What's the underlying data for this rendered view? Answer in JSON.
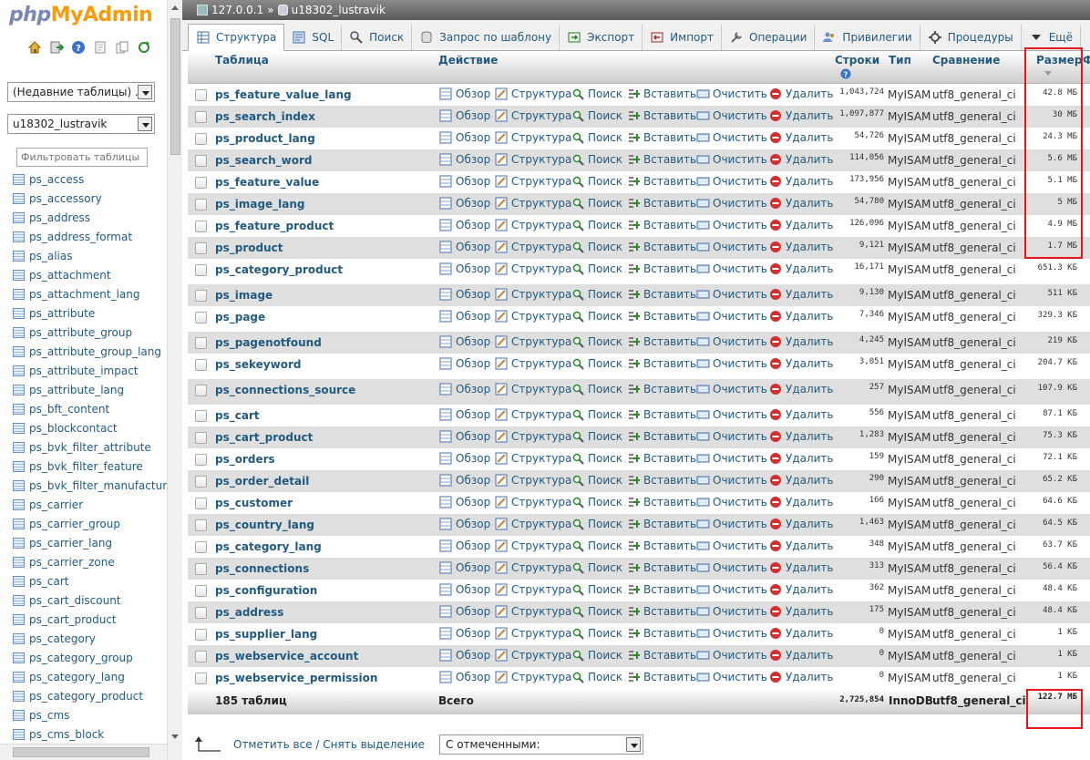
{
  "app": {
    "logo_php": "php",
    "logo_my": "My",
    "logo_admin": "Admin"
  },
  "left": {
    "recent_select": "(Недавние таблицы) ...",
    "db_select": "u18302_lustravik",
    "filter_placeholder": "Фильтровать таблицы по",
    "tables": [
      "ps_access",
      "ps_accessory",
      "ps_address",
      "ps_address_format",
      "ps_alias",
      "ps_attachment",
      "ps_attachment_lang",
      "ps_attribute",
      "ps_attribute_group",
      "ps_attribute_group_lang",
      "ps_attribute_impact",
      "ps_attribute_lang",
      "ps_bft_content",
      "ps_blockcontact",
      "ps_bvk_filter_attribute",
      "ps_bvk_filter_feature",
      "ps_bvk_filter_manufacturer",
      "ps_carrier",
      "ps_carrier_group",
      "ps_carrier_lang",
      "ps_carrier_zone",
      "ps_cart",
      "ps_cart_discount",
      "ps_cart_product",
      "ps_category",
      "ps_category_group",
      "ps_category_lang",
      "ps_category_product",
      "ps_cms",
      "ps_cms_block"
    ]
  },
  "breadcrumb": {
    "server": "127.0.0.1",
    "sep": "»",
    "database": "u18302_lustravik"
  },
  "tabs": [
    {
      "label": "Структура",
      "active": true
    },
    {
      "label": "SQL"
    },
    {
      "label": "Поиск"
    },
    {
      "label": "Запрос по шаблону"
    },
    {
      "label": "Экспорт"
    },
    {
      "label": "Импорт"
    },
    {
      "label": "Операции"
    },
    {
      "label": "Привилегии"
    },
    {
      "label": "Процедуры"
    },
    {
      "label": "Ещё"
    }
  ],
  "columns": {
    "table": "Таблица",
    "action": "Действие",
    "rows": "Строки",
    "type": "Тип",
    "collation": "Сравнение",
    "size": "Размер",
    "overhead_cut": "Ф"
  },
  "actions": {
    "browse": "Обзор",
    "structure": "Структура",
    "search": "Поиск",
    "insert": "Вставить",
    "empty": "Очистить",
    "drop": "Удалить"
  },
  "rows": [
    {
      "name": "ps_feature_value_lang",
      "rows": "1,043,724",
      "engine": "MyISAM",
      "collation": "utf8_general_ci",
      "size": "42.8 МБ"
    },
    {
      "name": "ps_search_index",
      "rows": "1,097,877",
      "engine": "MyISAM",
      "collation": "utf8_general_ci",
      "size": "30 МБ"
    },
    {
      "name": "ps_product_lang",
      "rows": "54,726",
      "engine": "MyISAM",
      "collation": "utf8_general_ci",
      "size": "24.3 МБ"
    },
    {
      "name": "ps_search_word",
      "rows": "114,056",
      "engine": "MyISAM",
      "collation": "utf8_general_ci",
      "size": "5.6 МБ"
    },
    {
      "name": "ps_feature_value",
      "rows": "173,956",
      "engine": "MyISAM",
      "collation": "utf8_general_ci",
      "size": "5.1 МБ"
    },
    {
      "name": "ps_image_lang",
      "rows": "54,780",
      "engine": "MyISAM",
      "collation": "utf8_general_ci",
      "size": "5 МБ"
    },
    {
      "name": "ps_feature_product",
      "rows": "126,096",
      "engine": "MyISAM",
      "collation": "utf8_general_ci",
      "size": "4.9 МБ"
    },
    {
      "name": "ps_product",
      "rows": "9,121",
      "engine": "MyISAM",
      "collation": "utf8_general_ci",
      "size": "1.7 МБ"
    },
    {
      "name": "ps_category_product",
      "rows": "16,171",
      "engine": "MyISAM",
      "collation": "utf8_general_ci",
      "size": "651.3 КБ"
    },
    {
      "name": "ps_image",
      "rows": "9,130",
      "engine": "MyISAM",
      "collation": "utf8_general_ci",
      "size": "511 КБ"
    },
    {
      "name": "ps_page",
      "rows": "7,346",
      "engine": "MyISAM",
      "collation": "utf8_general_ci",
      "size": "329.3 КБ"
    },
    {
      "name": "ps_pagenotfound",
      "rows": "4,245",
      "engine": "MyISAM",
      "collation": "utf8_general_ci",
      "size": "219 КБ"
    },
    {
      "name": "ps_sekeyword",
      "rows": "3,051",
      "engine": "MyISAM",
      "collation": "utf8_general_ci",
      "size": "204.7 КБ"
    },
    {
      "name": "ps_connections_source",
      "rows": "257",
      "engine": "MyISAM",
      "collation": "utf8_general_ci",
      "size": "107.9 КБ"
    },
    {
      "name": "ps_cart",
      "rows": "556",
      "engine": "MyISAM",
      "collation": "utf8_general_ci",
      "size": "87.1 КБ"
    },
    {
      "name": "ps_cart_product",
      "rows": "1,283",
      "engine": "MyISAM",
      "collation": "utf8_general_ci",
      "size": "75.3 КБ"
    },
    {
      "name": "ps_orders",
      "rows": "159",
      "engine": "MyISAM",
      "collation": "utf8_general_ci",
      "size": "72.1 КБ"
    },
    {
      "name": "ps_order_detail",
      "rows": "290",
      "engine": "MyISAM",
      "collation": "utf8_general_ci",
      "size": "65.2 КБ"
    },
    {
      "name": "ps_customer",
      "rows": "166",
      "engine": "MyISAM",
      "collation": "utf8_general_ci",
      "size": "64.6 КБ"
    },
    {
      "name": "ps_country_lang",
      "rows": "1,463",
      "engine": "MyISAM",
      "collation": "utf8_general_ci",
      "size": "64.5 КБ"
    },
    {
      "name": "ps_category_lang",
      "rows": "348",
      "engine": "MyISAM",
      "collation": "utf8_general_ci",
      "size": "63.7 КБ"
    },
    {
      "name": "ps_connections",
      "rows": "313",
      "engine": "MyISAM",
      "collation": "utf8_general_ci",
      "size": "56.4 КБ"
    },
    {
      "name": "ps_configuration",
      "rows": "362",
      "engine": "MyISAM",
      "collation": "utf8_general_ci",
      "size": "48.4 КБ"
    },
    {
      "name": "ps_address",
      "rows": "175",
      "engine": "MyISAM",
      "collation": "utf8_general_ci",
      "size": "48.4 КБ"
    },
    {
      "name": "ps_supplier_lang",
      "rows": "0",
      "engine": "MyISAM",
      "collation": "utf8_general_ci",
      "size": "1 КБ"
    },
    {
      "name": "ps_webservice_account",
      "rows": "0",
      "engine": "MyISAM",
      "collation": "utf8_general_ci",
      "size": "1 КБ"
    },
    {
      "name": "ps_webservice_permission",
      "rows": "0",
      "engine": "MyISAM",
      "collation": "utf8_general_ci",
      "size": "1 КБ"
    }
  ],
  "footer": {
    "count": "185 таблиц",
    "total": "Всего",
    "rows": "2,725,854",
    "engine": "InnoDB",
    "collation": "utf8_general_ci",
    "size": "122.7 МБ"
  },
  "bottom": {
    "markall": "Отметить все / Снять выделение",
    "with_selected": "С отмеченными:"
  },
  "colors": {
    "link": "#235a81",
    "highlight": "#e8161c",
    "row_alt": "#dfdfdf"
  }
}
